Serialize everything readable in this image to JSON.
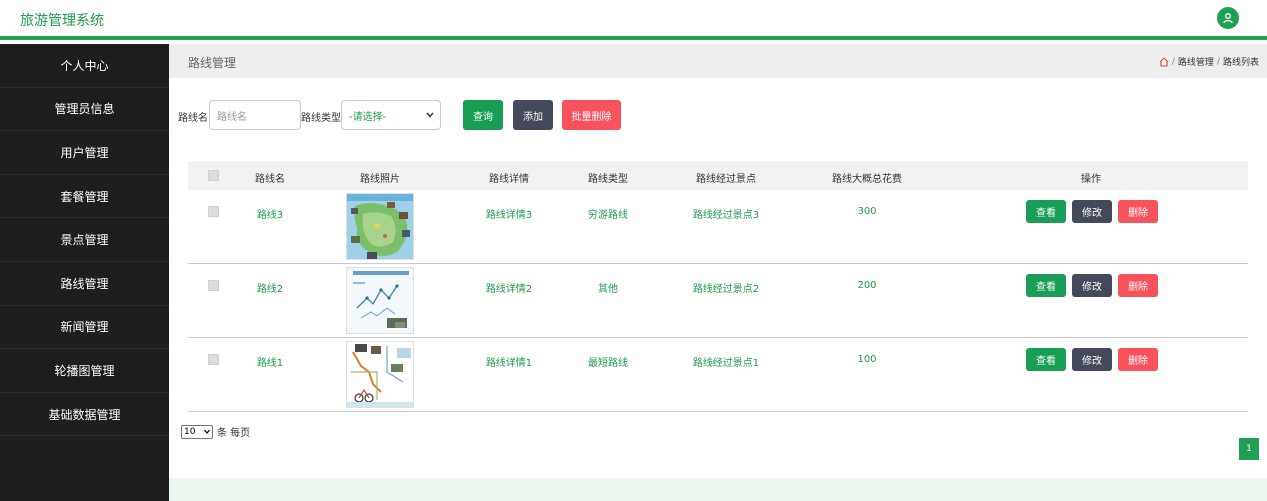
{
  "app": {
    "title": "旅游管理系统"
  },
  "sidebar": {
    "items": [
      {
        "label": "个人中心"
      },
      {
        "label": "管理员信息"
      },
      {
        "label": "用户管理"
      },
      {
        "label": "套餐管理"
      },
      {
        "label": "景点管理"
      },
      {
        "label": "路线管理"
      },
      {
        "label": "新闻管理"
      },
      {
        "label": "轮播图管理"
      },
      {
        "label": "基础数据管理"
      }
    ]
  },
  "breadcrumb": {
    "page_title": "路线管理",
    "path": [
      "路线管理",
      "路线列表"
    ],
    "separator": "/"
  },
  "search": {
    "name_label": "路线名",
    "name_placeholder": "路线名",
    "type_label": "路线类型",
    "type_selected": "-请选择-",
    "query_button": "查询",
    "add_button": "添加",
    "batch_delete_button": "批量删除"
  },
  "table": {
    "headers": [
      "路线名",
      "路线照片",
      "路线详情",
      "路线类型",
      "路线经过景点",
      "路线大概总花费",
      "操作"
    ],
    "rows": [
      {
        "name": "路线3",
        "detail": "路线详情3",
        "type": "穷游路线",
        "spots": "路线经过景点3",
        "cost": "300"
      },
      {
        "name": "路线2",
        "detail": "路线详情2",
        "type": "其他",
        "spots": "路线经过景点2",
        "cost": "200"
      },
      {
        "name": "路线1",
        "detail": "路线详情1",
        "type": "最短路线",
        "spots": "路线经过景点1",
        "cost": "100"
      }
    ],
    "actions": {
      "view": "查看",
      "edit": "修改",
      "delete": "删除"
    }
  },
  "pagination": {
    "page_size": "10",
    "page_size_suffix": "条 每页",
    "current_page": "1"
  },
  "colors": {
    "accent": "#1fa052",
    "sidebar_bg": "#1e1e1e",
    "danger": "#f8525c",
    "dark_button": "#454a5b"
  }
}
